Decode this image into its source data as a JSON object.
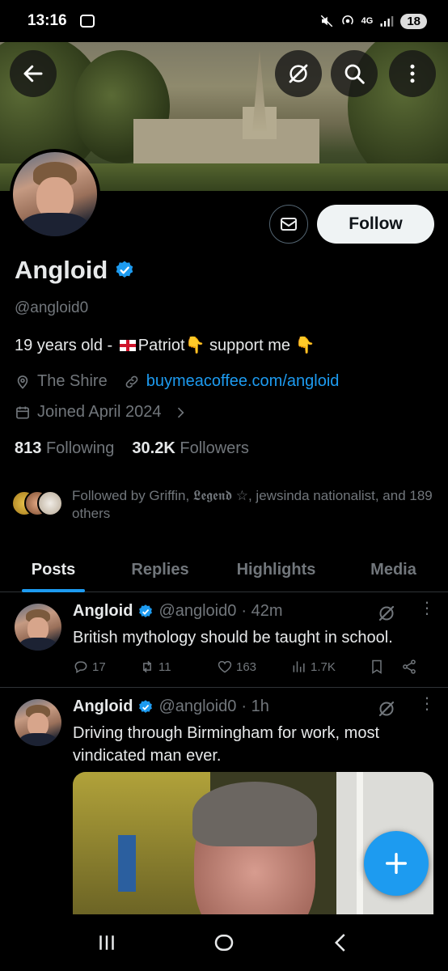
{
  "status_bar": {
    "time": "13:16",
    "network": "4G",
    "battery": "18"
  },
  "profile": {
    "name": "Angloid",
    "handle": "@angloid0",
    "bio_prefix": "19 years old - ",
    "bio_mid": "Patriot",
    "bio_suffix": " support me ",
    "emoji_point": "👇",
    "location": "The Shire",
    "website": "buymeacoffee.com/angloid",
    "joined": "Joined April 2024",
    "following_count": "813",
    "following_label": "Following",
    "followers_count": "30.2K",
    "followers_label": "Followers",
    "followed_by": "Followed by Griffin, 𝕷𝖊𝖌𝖊𝖓𝖉 ☆, jewsinda nationalist, and 189 others",
    "follow_label": "Follow"
  },
  "tabs": [
    {
      "label": "Posts",
      "active": true
    },
    {
      "label": "Replies",
      "active": false
    },
    {
      "label": "Highlights",
      "active": false
    },
    {
      "label": "Media",
      "active": false
    }
  ],
  "tweets": [
    {
      "name": "Angloid",
      "handle": "@angloid0",
      "time": "· 42m",
      "text": "British mythology should be taught in school.",
      "replies": "17",
      "reposts": "11",
      "likes": "163",
      "views": "1.7K"
    },
    {
      "name": "Angloid",
      "handle": "@angloid0",
      "time": "· 1h",
      "text": "Driving through Birmingham for work, most vindicated man ever."
    }
  ],
  "colors": {
    "accent": "#1d9bf0",
    "background": "#000000",
    "muted": "#71767b"
  },
  "icons": {
    "back": "arrow-left-icon",
    "grok": "grok-icon",
    "search": "search-icon",
    "more": "more-vertical-icon",
    "message": "envelope-icon",
    "compose": "plus-icon"
  }
}
